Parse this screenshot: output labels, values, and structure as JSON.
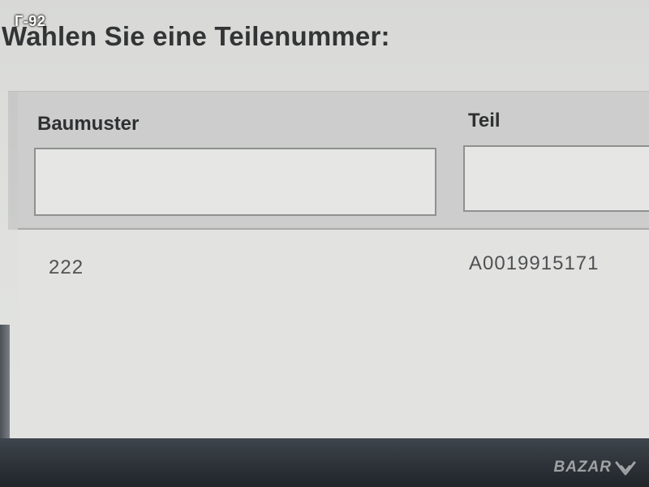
{
  "overlay": {
    "corner_tag": "Г-92",
    "watermark": "BAZAR"
  },
  "page": {
    "title": "Wahlen Sie eine Teilenummer:"
  },
  "filters": {
    "columns": [
      {
        "label": "Baumuster",
        "value": ""
      },
      {
        "label": "Teil",
        "value": ""
      }
    ]
  },
  "results": {
    "rows": [
      {
        "baumuster": "222",
        "teil": "A0019915171"
      }
    ]
  },
  "colors": {
    "panel": "#cccdcc",
    "input_bg": "#e6e7e5",
    "input_border": "#8f9190",
    "text_dark": "#333436",
    "bezel": "#2b3136"
  }
}
